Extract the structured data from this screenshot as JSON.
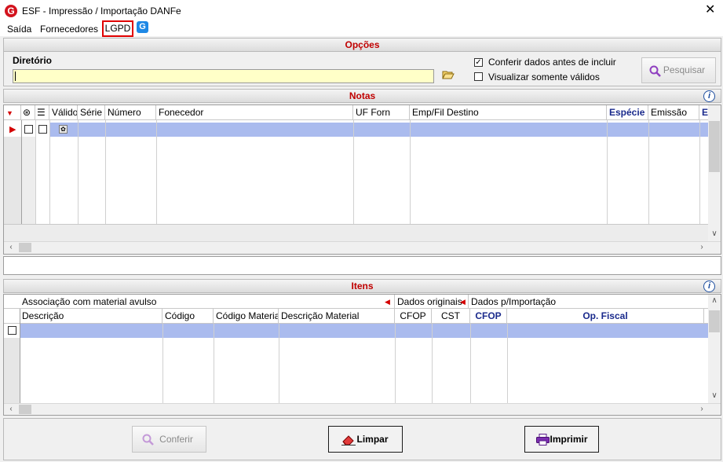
{
  "window": {
    "title": "ESF - Impressão / Importação DANFe",
    "logo_letter": "G",
    "close_glyph": "✕"
  },
  "menu": {
    "items": [
      "Saída",
      "Fornecedores",
      "LGPD"
    ],
    "icon_letter": "G"
  },
  "opcoes": {
    "header": "Opções",
    "dir_label": "Diretório",
    "dir_value": "",
    "check_conferir": {
      "label": "Conferir dados antes de incluir",
      "checked": true
    },
    "check_validos": {
      "label": "Visualizar somente válidos",
      "checked": false
    },
    "search_button": "Pesquisar"
  },
  "notas": {
    "header": "Notas",
    "columns": [
      "Válido",
      "Série",
      "Número",
      "Fonecedor",
      "UF Forn",
      "Emp/Fil Destino",
      "Espécie",
      "Emissão",
      "E"
    ]
  },
  "itens": {
    "header": "Itens",
    "groups": [
      "Associação com material avulso",
      "Dados originais",
      "Dados p/Importação"
    ],
    "columns": [
      "Descrição",
      "Código",
      "Código Material",
      "Descrição Material",
      "CFOP",
      "CST",
      "CFOP",
      "Op. Fiscal"
    ]
  },
  "buttons": {
    "conferir": "Conferir",
    "limpar": "Limpar",
    "imprimir": "Imprimir"
  },
  "colors": {
    "accent_red": "#c00000",
    "selection": "#aabbee",
    "dir_bg": "#ffffc8",
    "header_blue": "#1a2a8c"
  }
}
